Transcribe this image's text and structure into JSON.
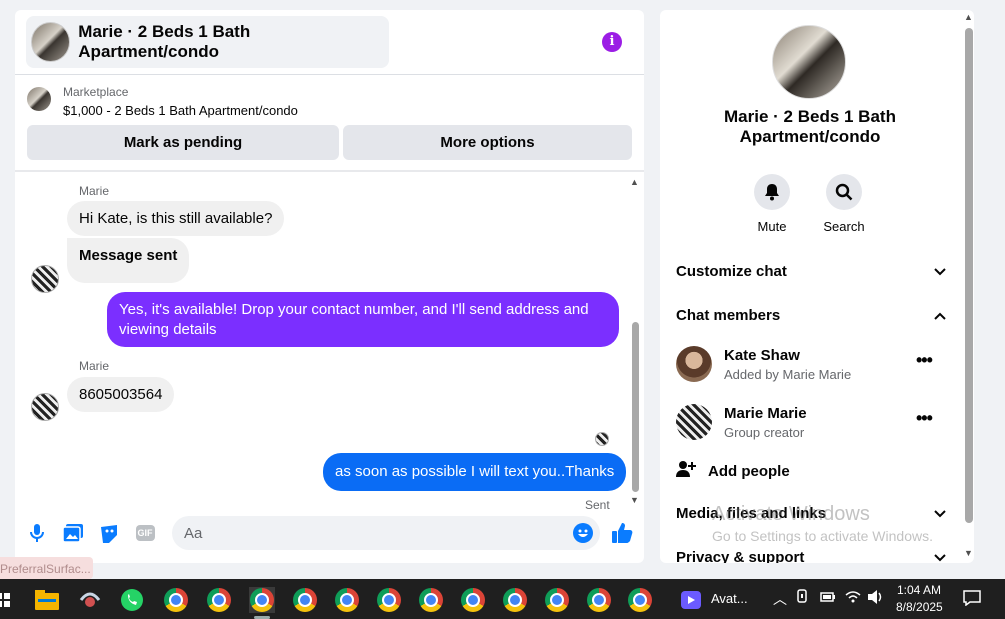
{
  "chat": {
    "title": "Marie · 2 Beds 1 Bath Apartment/condo",
    "marketplace_label": "Marketplace",
    "listing": "$1,000 - 2 Beds 1 Bath Apartment/condo",
    "buttons": {
      "pending": "Mark as pending",
      "more": "More options"
    },
    "messages": [
      {
        "sender": "Marie",
        "text": "Hi Kate, is this still available?"
      },
      {
        "text": "Message sent"
      },
      {
        "text": "Yes, it's available! Drop your contact number, and I'll send address and viewing details"
      },
      {
        "sender": "Marie",
        "text": "8605003564"
      },
      {
        "text": "as soon as possible I will text you..Thanks",
        "status": "Sent"
      }
    ],
    "composer": {
      "placeholder": "Aa",
      "gif_label": "GIF"
    }
  },
  "info": {
    "title": "Marie · 2 Beds 1 Bath Apartment/condo",
    "actions": [
      {
        "label": "Mute"
      },
      {
        "label": "Search"
      }
    ],
    "sections": {
      "customize": "Customize chat",
      "members": "Chat members",
      "media": "Media, files and links",
      "privacy": "Privacy & support"
    },
    "members": [
      {
        "name": "Kate Shaw",
        "sub": "Added by Marie Marie"
      },
      {
        "name": "Marie Marie",
        "sub": "Group creator"
      }
    ],
    "add_people": "Add people"
  },
  "watermark": {
    "line1": "Activate Windows",
    "line2": "Go to Settings to activate Windows."
  },
  "ref_chip": "PreferralSurfac...",
  "taskbar": {
    "app_label": "Avat...",
    "time": "1:04 AM",
    "date": "8/8/2025"
  },
  "colors": {
    "accent": "#0a7cff",
    "bubble_purple": "#7b2fff",
    "info_purple": "#9b1de5"
  }
}
